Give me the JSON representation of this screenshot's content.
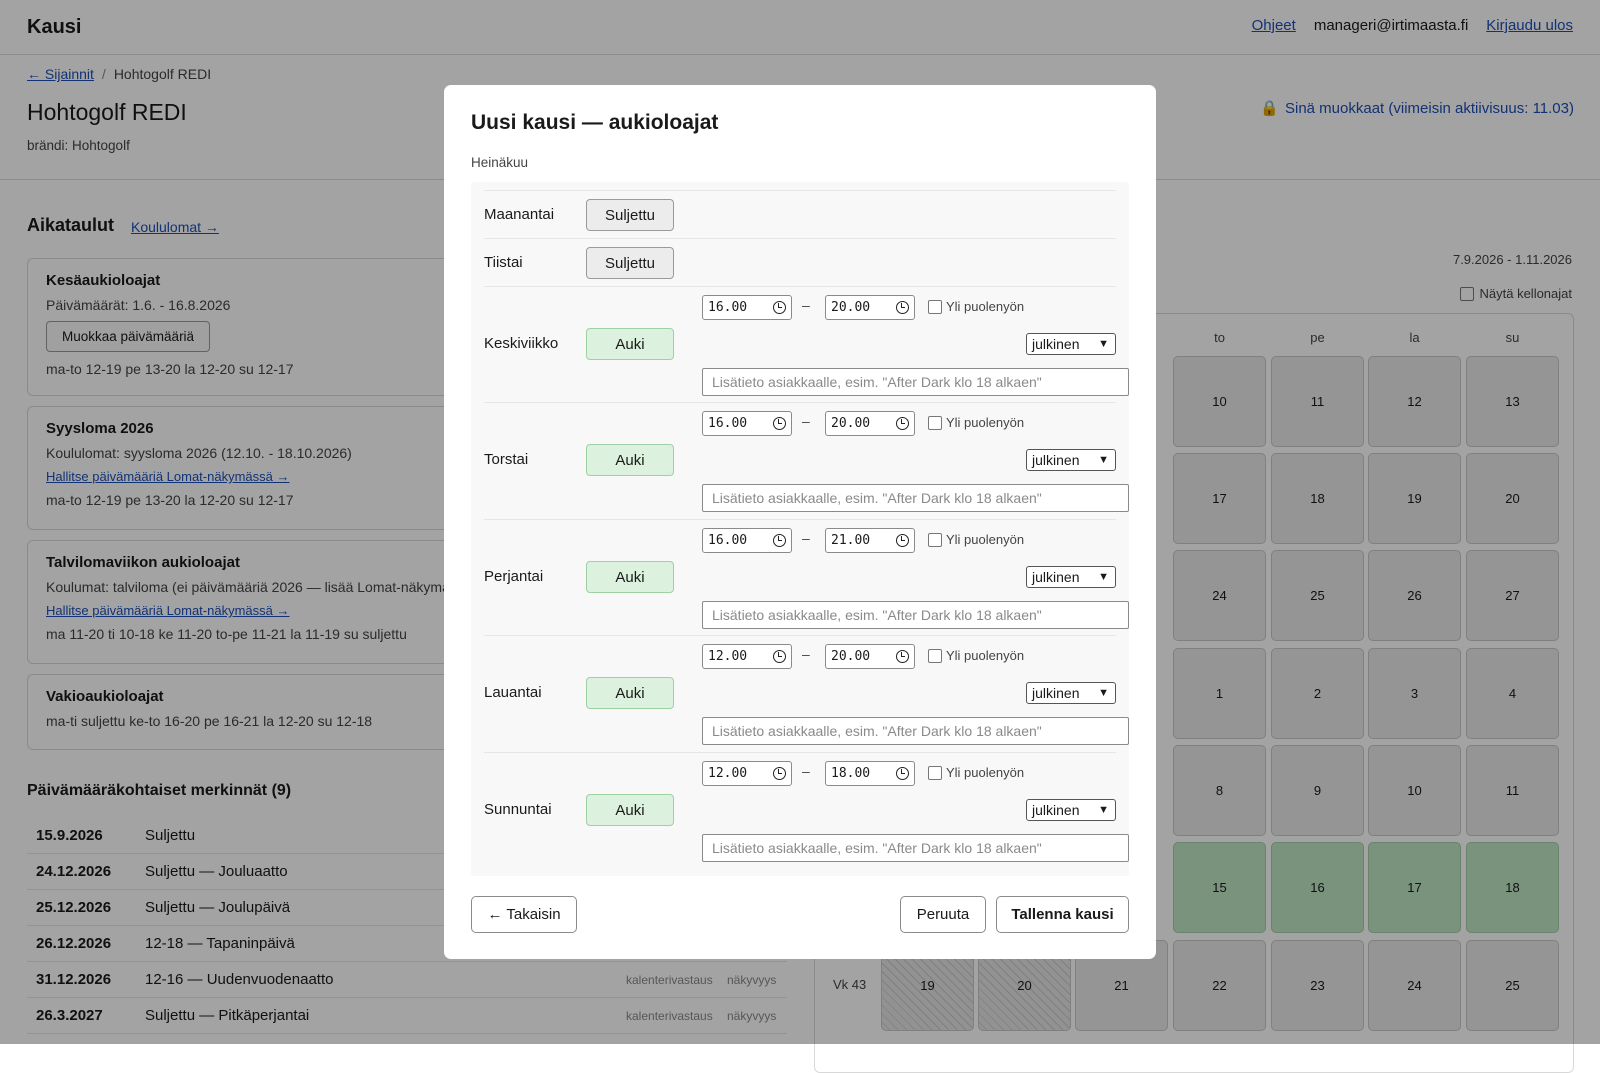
{
  "app": {
    "title": "Kausi"
  },
  "topnav": {
    "help": "Ohjeet",
    "user": "manageri@irtimaasta.fi",
    "logout": "Kirjaudu ulos"
  },
  "breadcrumb": {
    "back": "← Sijainnit",
    "sep": "/",
    "current": "Hohtogolf REDI"
  },
  "location": {
    "title": "Hohtogolf REDI",
    "brand": "brändi: Hohtogolf"
  },
  "lock": {
    "icon": "lock-icon",
    "text": "Sinä muokkaat (viimeisin aktiivisuus: 11.03)"
  },
  "schedules": {
    "title": "Aikataulut",
    "link": "Koululomat →",
    "cards": [
      {
        "title": "Kesäaukioloajat",
        "line1": "Päivämäärät: 1.6. - 16.8.2026",
        "button": "Muokkaa päivämääriä",
        "hours": "ma-to 12-19 pe 13-20 la 12-20 su 12-17"
      },
      {
        "title": "Syysloma 2026",
        "line1": "Koululomat: syysloma 2026 (12.10. - 18.10.2026)",
        "link": "Hallitse päivämääriä Lomat-näkymässä →",
        "hours": "ma-to 12-19 pe 13-20 la 12-20 su 12-17"
      },
      {
        "title": "Talvilomaviikon aukioloajat",
        "line1": "Koulumat: talviloma (ei päivämääriä 2026 — lisää Lomat-näkymässä)",
        "link": "Hallitse päivämääriä Lomat-näkymässä →",
        "hours": "ma 11-20 ti 10-18 ke 11-20 to-pe 11-21 la 11-19 su suljettu"
      },
      {
        "title": "Vakioaukioloajat",
        "hours": "ma-ti suljettu ke-to 16-20 pe 16-21 la 12-20 su 12-18"
      }
    ]
  },
  "date_overrides": {
    "title": "Päivämääräkohtaiset merkinnät (9)",
    "rows": [
      {
        "date": "15.9.2026",
        "text": "Suljettu",
        "m1": "",
        "m2": ""
      },
      {
        "date": "24.12.2026",
        "text": "Suljettu — Jouluaatto",
        "m1": "",
        "m2": ""
      },
      {
        "date": "25.12.2026",
        "text": "Suljettu — Joulupäivä",
        "m1": "",
        "m2": ""
      },
      {
        "date": "26.12.2026",
        "text": "12-18 — Tapaninpäivä",
        "m1": "",
        "m2": ""
      },
      {
        "date": "31.12.2026",
        "text": "12-16 — Uudenvuodenaatto",
        "m1": "kalenterivastaus",
        "m2": "näkyvyys"
      },
      {
        "date": "26.3.2027",
        "text": "Suljettu — Pitkäperjantai",
        "m1": "kalenterivastaus",
        "m2": "näkyvyys"
      }
    ]
  },
  "calendar": {
    "range": "7.9.2026 - 1.11.2026",
    "show_times": "Näytä kellonajat",
    "dows": [
      "to",
      "pe",
      "la",
      "su"
    ],
    "week_label": "Vk 43",
    "rows": [
      [
        "10",
        "11",
        "12",
        "13"
      ],
      [
        "17",
        "18",
        "19",
        "20"
      ],
      [
        "24",
        "25",
        "26",
        "27"
      ],
      [
        "1",
        "2",
        "3",
        "4"
      ],
      [
        "8",
        "9",
        "10",
        "11"
      ],
      [
        "15",
        "16",
        "17",
        "18"
      ]
    ],
    "last_row": [
      "19",
      "20",
      "21",
      "22",
      "23",
      "24",
      "25"
    ]
  },
  "modal": {
    "title": "Uusi kausi — aukioloajat",
    "subtitle": "Heinäkuu",
    "closed_label": "Suljettu",
    "open_label": "Auki",
    "midnight_label": "Yli puolenyön",
    "visibility": "julkinen",
    "note_placeholder": "Lisätieto asiakkaalle, esim. \"After Dark klo 18 alkaen\"",
    "days": [
      {
        "name": "Maanantai",
        "open": false
      },
      {
        "name": "Tiistai",
        "open": false
      },
      {
        "name": "Keskiviikko",
        "open": true,
        "from": "16.00",
        "to": "20.00"
      },
      {
        "name": "Torstai",
        "open": true,
        "from": "16.00",
        "to": "20.00"
      },
      {
        "name": "Perjantai",
        "open": true,
        "from": "16.00",
        "to": "21.00"
      },
      {
        "name": "Lauantai",
        "open": true,
        "from": "12.00",
        "to": "20.00"
      },
      {
        "name": "Sunnuntai",
        "open": true,
        "from": "12.00",
        "to": "18.00"
      }
    ],
    "back": "← Takaisin",
    "cancel": "Peruuta",
    "save": "Tallenna kausi"
  },
  "colors": {
    "link": "#1d4fb8",
    "open_green": "#dcf2de",
    "calendar_green": "#bfe6c2"
  }
}
